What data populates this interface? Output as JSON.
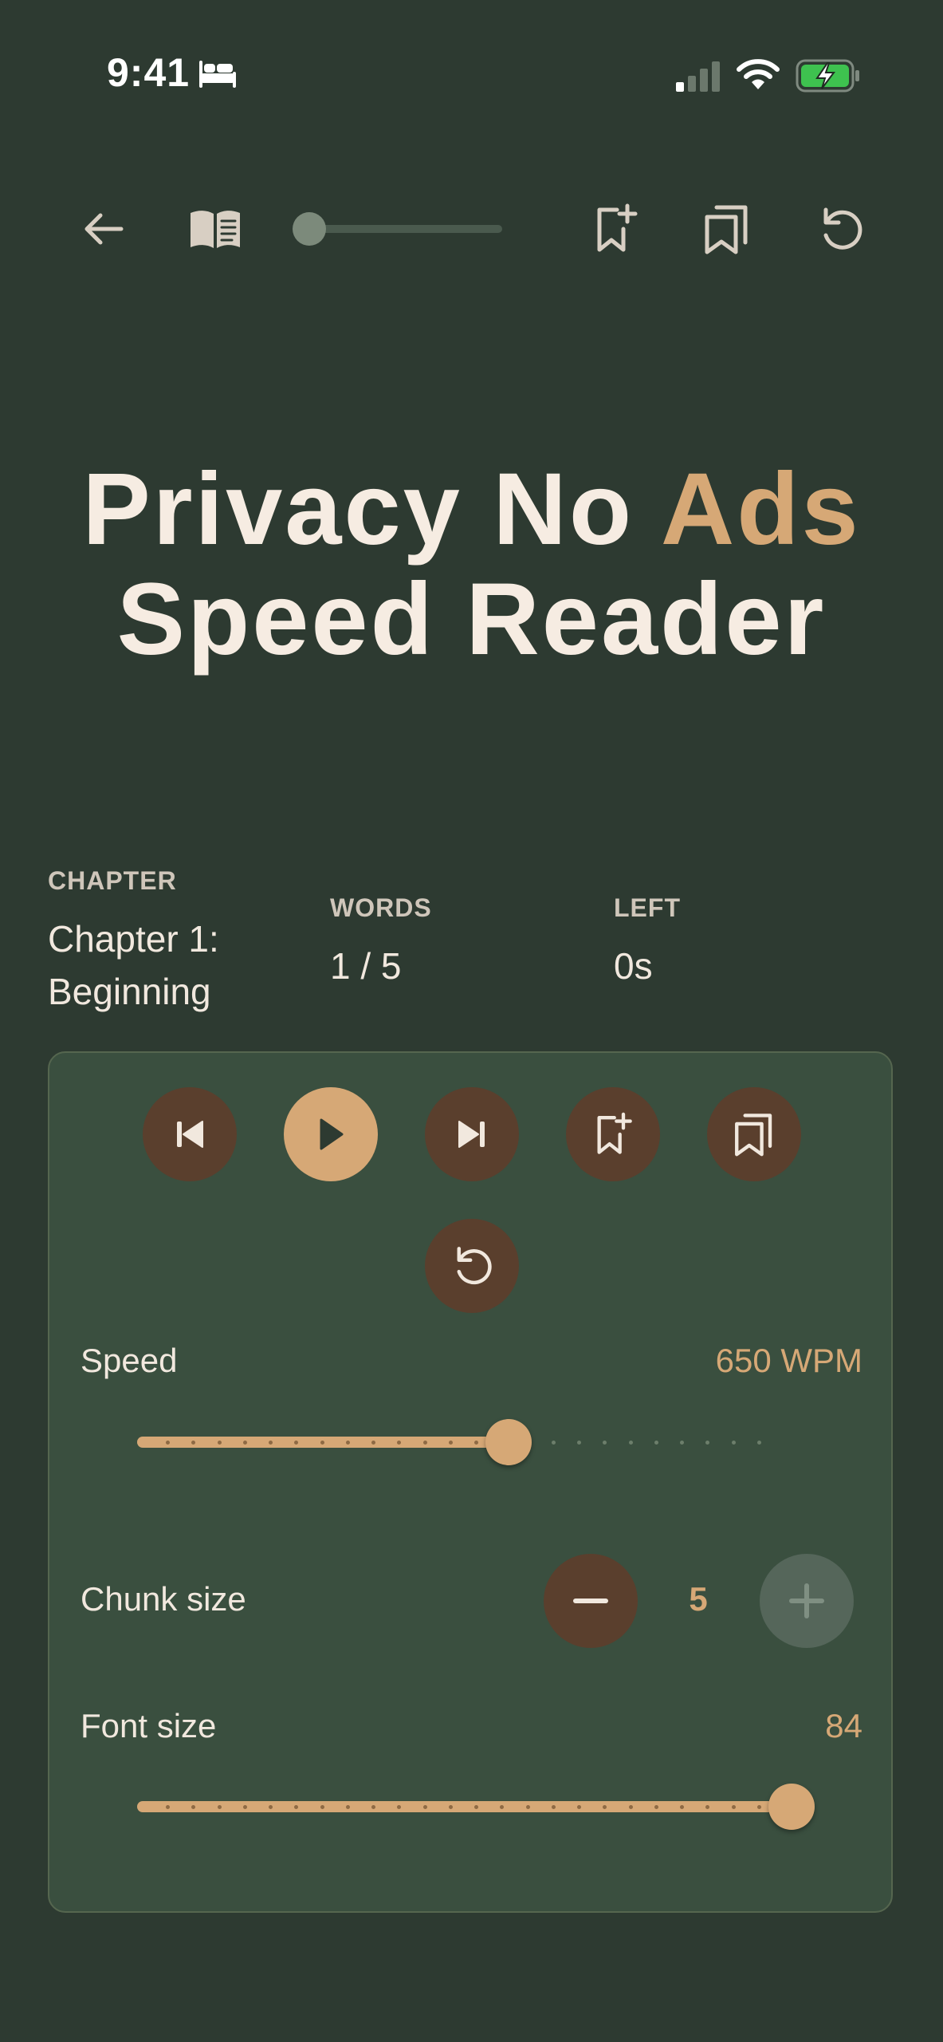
{
  "status_bar": {
    "time": "9:41",
    "icons": [
      "bed-icon",
      "cellular-signal-icon",
      "wifi-icon",
      "battery-charging-icon"
    ]
  },
  "toolbar": {
    "icons": [
      "back-arrow-icon",
      "book-open-icon",
      "bookmark-add-icon",
      "bookmarks-icon",
      "restart-icon"
    ],
    "progress_fraction": 0.0
  },
  "title": {
    "line1_part1": "Privacy No ",
    "line1_accent": "Ads",
    "line2": "Speed Reader"
  },
  "stats": {
    "chapter_label": "CHAPTER",
    "chapter_value_line1": "Chapter 1:",
    "chapter_value_line2": "Beginning",
    "words_label": "WORDS",
    "words_value": "1 / 5",
    "left_label": "LEFT",
    "left_value": "0s"
  },
  "controls": {
    "buttons": [
      "skip-previous-icon",
      "play-icon",
      "skip-next-icon",
      "bookmark-add-icon",
      "bookmarks-icon",
      "restart-icon"
    ]
  },
  "speed": {
    "label": "Speed",
    "value_text": "650 WPM",
    "fraction": 0.56
  },
  "chunk": {
    "label": "Chunk size",
    "value": "5"
  },
  "font_size": {
    "label": "Font size",
    "value": "84",
    "fraction": 1.0
  },
  "colors": {
    "background": "#2d3a31",
    "panel": "#3a4f3f",
    "accent": "#d6a876",
    "button_dark": "#5a3f2d",
    "text": "#f4ebe1"
  }
}
